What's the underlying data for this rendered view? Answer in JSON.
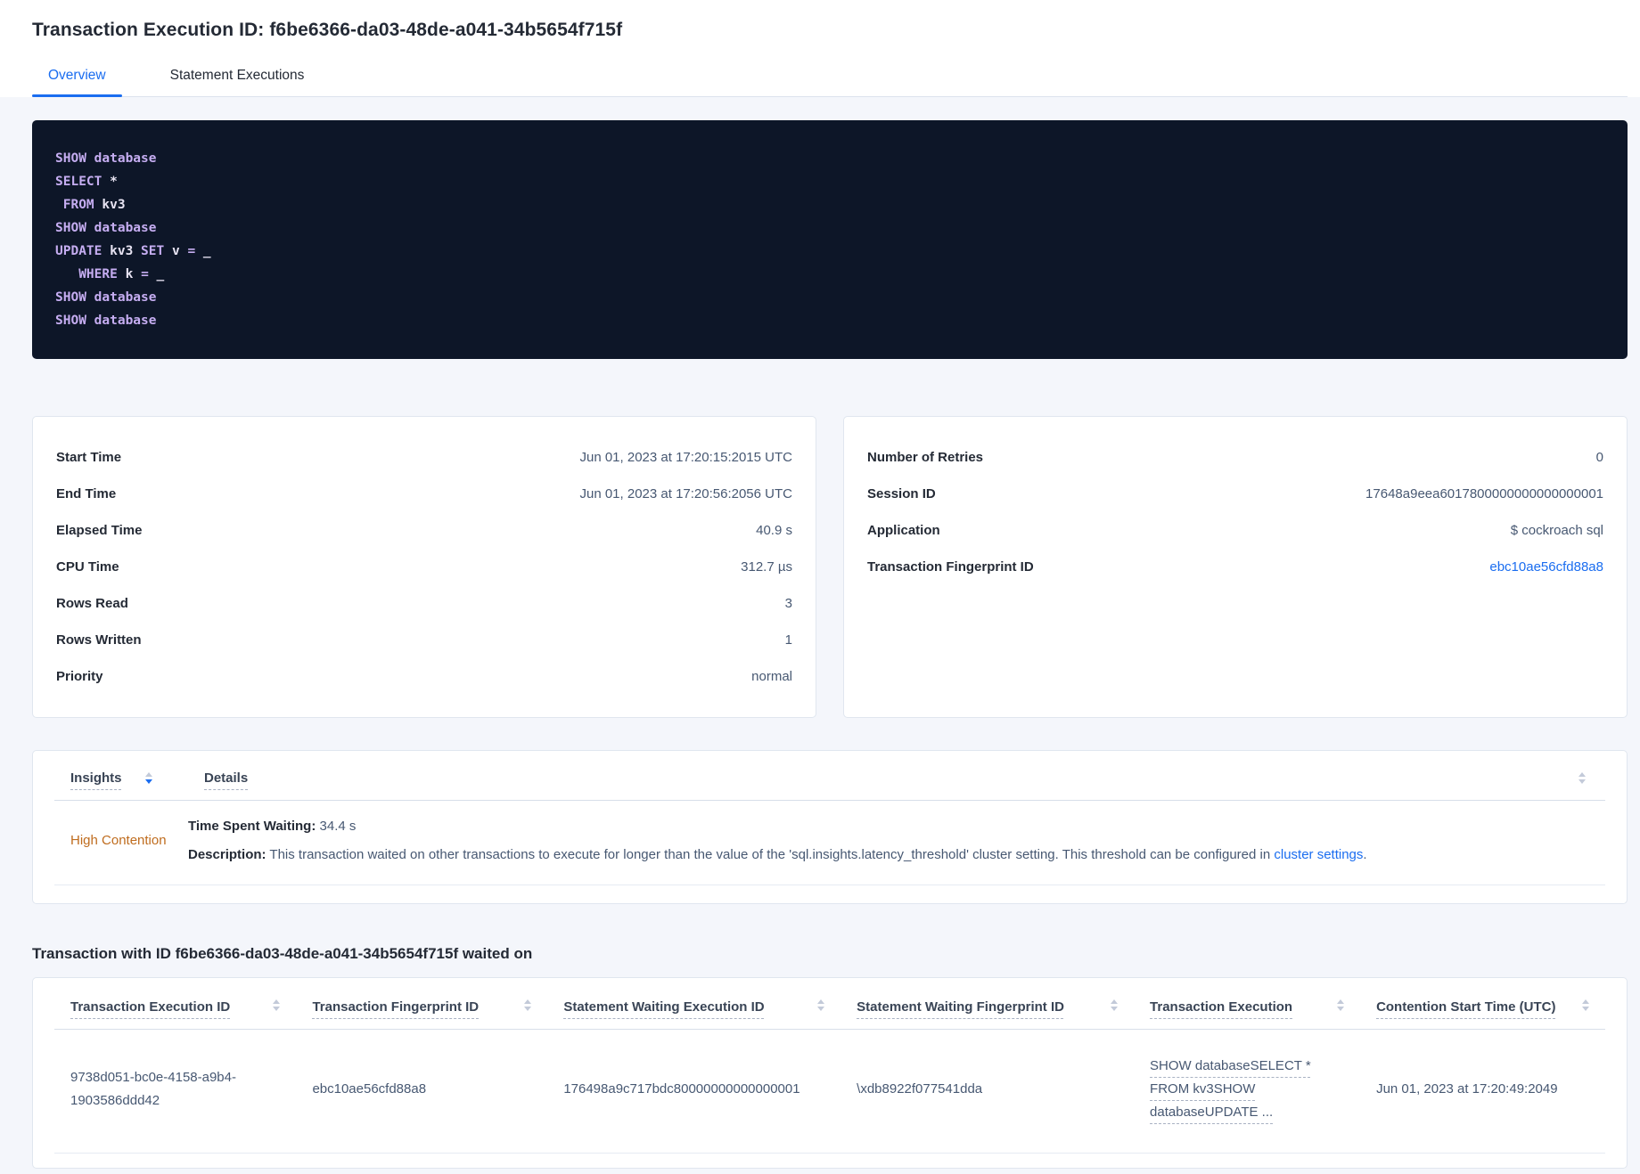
{
  "page": {
    "title": "Transaction Execution ID: f6be6366-da03-48de-a041-34b5654f715f"
  },
  "tabs": [
    {
      "label": "Overview",
      "active": true
    },
    {
      "label": "Statement Executions",
      "active": false
    }
  ],
  "colors": {
    "accent_blue": "#1a6df0",
    "insight_orange": "#bf6c1e",
    "code_background": "#0d1628",
    "code_keyword": "#c5adf1"
  },
  "sql": {
    "lines": [
      [
        [
          "SHOW",
          "k"
        ],
        [
          " ",
          "p"
        ],
        [
          "database",
          "k"
        ]
      ],
      [
        [
          "SELECT",
          "k"
        ],
        [
          " *",
          "p"
        ]
      ],
      [
        [
          " ",
          "p"
        ],
        [
          "FROM",
          "k"
        ],
        [
          " kv3",
          "p"
        ]
      ],
      [
        [
          "SHOW",
          "k"
        ],
        [
          " ",
          "p"
        ],
        [
          "database",
          "k"
        ]
      ],
      [
        [
          "UPDATE",
          "k"
        ],
        [
          " kv3 ",
          "p"
        ],
        [
          "SET",
          "k"
        ],
        [
          " v ",
          "p"
        ],
        [
          "=",
          "k"
        ],
        [
          " _",
          "p"
        ]
      ],
      [
        [
          "   ",
          "p"
        ],
        [
          "WHERE",
          "k"
        ],
        [
          " k ",
          "p"
        ],
        [
          "=",
          "k"
        ],
        [
          " _",
          "p"
        ]
      ],
      [
        [
          "SHOW",
          "k"
        ],
        [
          " ",
          "p"
        ],
        [
          "database",
          "k"
        ]
      ],
      [
        [
          "SHOW",
          "k"
        ],
        [
          " ",
          "p"
        ],
        [
          "database",
          "k"
        ]
      ]
    ]
  },
  "summary_left": {
    "rows": [
      {
        "label": "Start Time",
        "value": "Jun 01, 2023 at 17:20:15:2015 UTC"
      },
      {
        "label": "End Time",
        "value": "Jun 01, 2023 at 17:20:56:2056 UTC"
      },
      {
        "label": "Elapsed Time",
        "value": "40.9 s"
      },
      {
        "label": "CPU Time",
        "value": "312.7 µs"
      },
      {
        "label": "Rows Read",
        "value": "3"
      },
      {
        "label": "Rows Written",
        "value": "1"
      },
      {
        "label": "Priority",
        "value": "normal"
      }
    ]
  },
  "summary_right": {
    "rows": [
      {
        "label": "Number of Retries",
        "value": "0"
      },
      {
        "label": "Session ID",
        "value": "17648a9eea6017800000000000000001"
      },
      {
        "label": "Application",
        "value": "$ cockroach sql"
      },
      {
        "label": "Transaction Fingerprint ID",
        "value": "ebc10ae56cfd88a8",
        "link": true
      }
    ]
  },
  "insights": {
    "columns": [
      "Insights",
      "Details"
    ],
    "row": {
      "insight": "High Contention",
      "waiting_label": "Time Spent Waiting:",
      "waiting_value": " 34.4 s",
      "description_label": "Description:",
      "description_text": " This transaction waited on other transactions to execute for longer than the value of the 'sql.insights.latency_threshold' cluster setting. This threshold can be configured in ",
      "description_link": "cluster settings",
      "description_suffix": "."
    }
  },
  "waited_on": {
    "heading": "Transaction with ID f6be6366-da03-48de-a041-34b5654f715f waited on",
    "columns": [
      "Transaction Execution ID",
      "Transaction Fingerprint ID",
      "Statement Waiting Execution ID",
      "Statement Waiting Fingerprint ID",
      "Transaction Execution",
      "Contention Start Time (UTC)"
    ],
    "rows": [
      {
        "transaction_execution_id": "9738d051-bc0e-4158-a9b4-1903586ddd42",
        "transaction_fingerprint_id": "ebc10ae56cfd88a8",
        "statement_waiting_execution_id": "176498a9c717bdc80000000000000001",
        "statement_waiting_fingerprint_id": "\\xdb8922f077541dda",
        "transaction_execution": "SHOW databaseSELECT * FROM kv3SHOW databaseUPDATE ...",
        "contention_start_time": "Jun 01, 2023 at 17:20:49:2049"
      }
    ]
  }
}
